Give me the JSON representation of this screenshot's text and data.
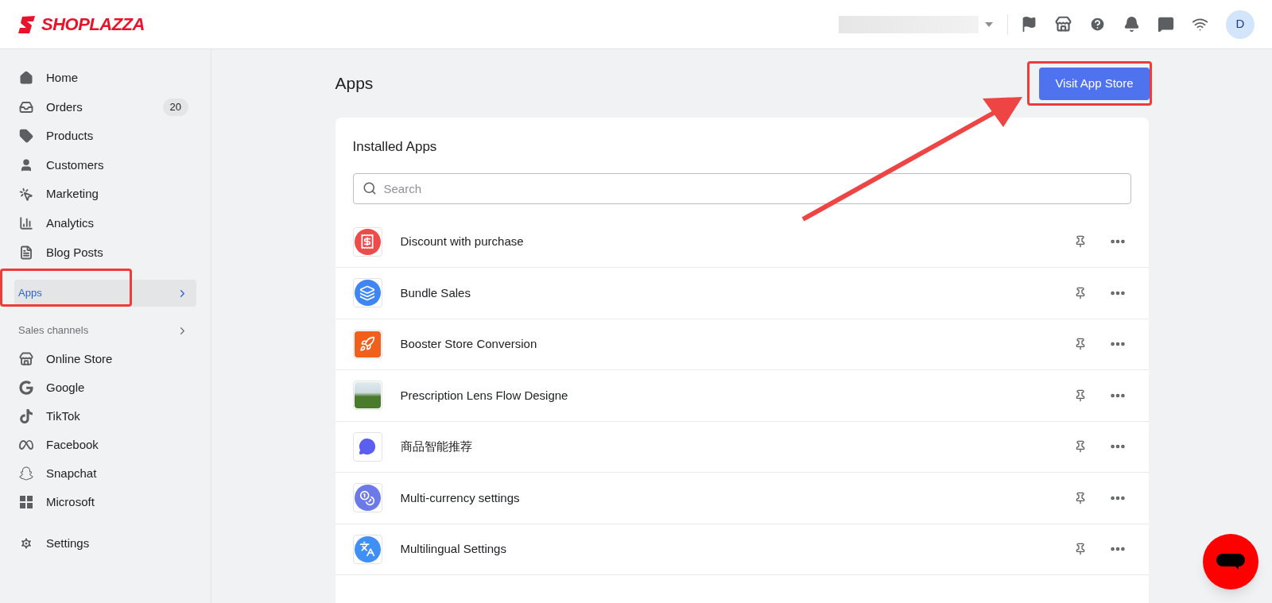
{
  "logo": {
    "text": "SHOPLAZZA"
  },
  "header": {
    "avatar": "D"
  },
  "sidebar": {
    "items": [
      {
        "label": "Home",
        "kind": "home",
        "selected": false
      },
      {
        "label": "Orders",
        "kind": "orders",
        "selected": false,
        "badge": "20"
      },
      {
        "label": "Products",
        "kind": "products",
        "selected": false
      },
      {
        "label": "Customers",
        "kind": "customers",
        "selected": false
      },
      {
        "label": "Marketing",
        "kind": "marketing",
        "selected": false
      },
      {
        "label": "Analytics",
        "kind": "analytics",
        "selected": false
      },
      {
        "label": "Blog Posts",
        "kind": "blog",
        "selected": false
      },
      {
        "label": "Apps",
        "selected": true
      }
    ],
    "section": "Sales channels",
    "channels": [
      {
        "label": "Online Store",
        "kind": "store"
      },
      {
        "label": "Google",
        "kind": "google"
      },
      {
        "label": "TikTok",
        "kind": "tiktok"
      },
      {
        "label": "Facebook",
        "kind": "meta"
      },
      {
        "label": "Snapchat",
        "kind": "snapchat"
      },
      {
        "label": "Microsoft",
        "kind": "microsoft"
      }
    ],
    "settings": "Settings"
  },
  "page": {
    "title": "Apps",
    "button": "Visit App Store"
  },
  "installed": {
    "title": "Installed Apps",
    "search": {
      "placeholder": "Search"
    },
    "apps": [
      {
        "name": "Discount with purchase",
        "kind": "receipt",
        "color": "#f04b4b"
      },
      {
        "name": "Bundle Sales",
        "kind": "layers",
        "color": "#3f86f4"
      },
      {
        "name": "Booster Store Conversion",
        "kind": "rocket",
        "color": "#f0601c"
      },
      {
        "name": "Prescription Lens Flow Designe",
        "kind": "photo",
        "color": "#4a7a2c"
      },
      {
        "name": "商品智能推荐",
        "kind": "chat",
        "color": "#ffffff"
      },
      {
        "name": "Multi-currency settings",
        "kind": "currency",
        "color": "#6c79e8"
      },
      {
        "name": "Multilingual Settings",
        "kind": "translate",
        "color": "#3f8ff4"
      }
    ]
  }
}
